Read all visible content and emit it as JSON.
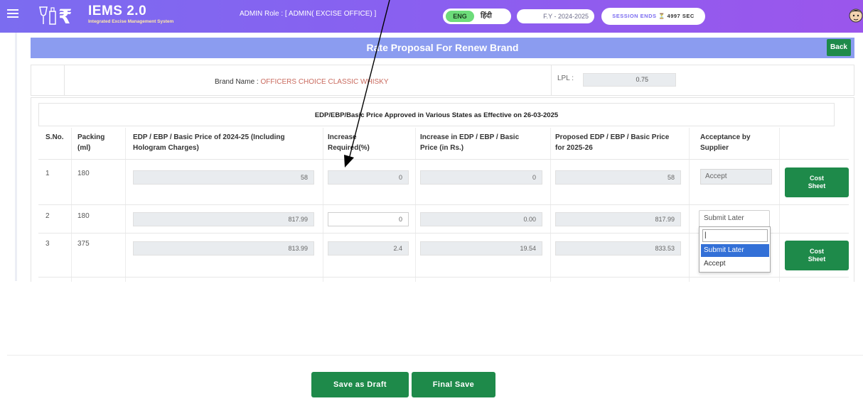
{
  "header": {
    "app_name": "IEMS  2.0",
    "app_subtitle": "Integrated Excise Management System",
    "admin_role": "ADMIN Role : [ ADMIN( EXCISE OFFICE) ]",
    "lang_english": "ENG",
    "lang_hindi": "हिंदी",
    "fiscal_year": "F.Y - 2024-2025",
    "session_label": "SESSION ENDS",
    "session_timer": "4997 SEC",
    "colors": {
      "header_start": "#7b6cf0",
      "header_end": "#9b56ec",
      "lang_active": "#6ddc7a"
    }
  },
  "page": {
    "title": "Rate Proposal For Renew Brand",
    "back_label": "Back",
    "title_bar_color": "#8b9cf0",
    "button_color": "#1e8a4a"
  },
  "brand": {
    "label": "Brand Name : ",
    "value": "OFFICERS CHOICE CLASSIC WHISKY",
    "lpl_label": "LPL :",
    "lpl_value": "0.75"
  },
  "table": {
    "note": "EDP/EBP/Basic Price Approved in Various States as Effective on 26-03-2025",
    "headers": {
      "sno": "S.No.",
      "packing_1": "Packing",
      "packing_2": "(ml)",
      "edp_1": "EDP / EBP / Basic Price of 2024-25 (Including",
      "edp_2": "Hologram Charges)",
      "increase_1": "Increase",
      "increase_2": "Required(%)",
      "inc_rs_1": "Increase in EDP / EBP / Basic",
      "inc_rs_2": "Price (in Rs.)",
      "proposed_1": "Proposed EDP / EBP / Basic Price",
      "proposed_2": "for 2025-26",
      "accept_1": "Acceptance by",
      "accept_2": "Supplier"
    },
    "rows": [
      {
        "sno": "1",
        "packing": "180",
        "edp": "58",
        "increase_pct": "0",
        "increase_rs": "0",
        "proposed": "58",
        "acceptance": "Accept",
        "cost_sheet_1": "Cost",
        "cost_sheet_2": "Sheet"
      },
      {
        "sno": "2",
        "packing": "180",
        "edp": "817.99",
        "increase_pct": "0",
        "increase_rs": "0.00",
        "proposed": "817.99",
        "acceptance": "Submit Later"
      },
      {
        "sno": "3",
        "packing": "375",
        "edp": "813.99",
        "increase_pct": "2.4",
        "increase_rs": "19.54",
        "proposed": "833.53",
        "cost_sheet_1": "Cost",
        "cost_sheet_2": "Sheet"
      }
    ],
    "dropdown": {
      "search_value": "|",
      "options": [
        "Submit Later",
        "Accept"
      ],
      "highlighted": "Submit Later"
    }
  },
  "footer": {
    "save_draft_label": "Save as Draft",
    "final_save_label": "Final Save"
  }
}
